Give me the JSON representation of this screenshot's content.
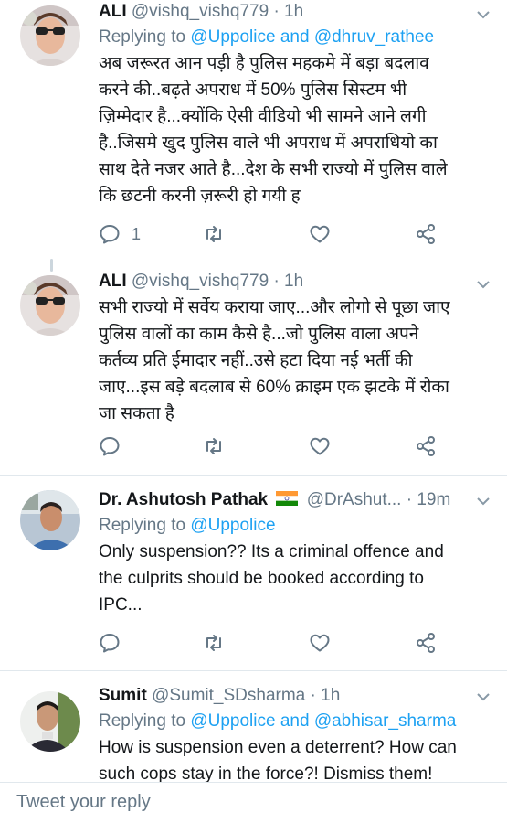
{
  "tweets": [
    {
      "name": "ALI",
      "handle": "@vishq_vishq779",
      "time": "1h",
      "replying_prefix": "Replying to",
      "replying_to": "@Uppolice and @dhruv_rathee",
      "lines": [
        "अब जरूरत आन पड़ी है पुलिस महकमे में बड़ा बदलाव",
        "करने की..बढ़ते अपराध में 50% पुलिस सिस्टम भी",
        "ज़िम्मेदार है...क्योंकि ऐसी वीडियो भी सामने आने लगी",
        "है..जिसमे खुद पुलिस वाले भी अपराध में  अपराधियो का",
        "साथ देते नजर आते है...देश के सभी राज्यो में पुलिस वाले",
        "कि छटनी करनी ज़रूरी हो गयी ह"
      ],
      "reply_count": "1"
    },
    {
      "name": "ALI",
      "handle": "@vishq_vishq779",
      "time": "1h",
      "lines": [
        "सभी राज्यो में सर्वेय कराया जाए...और लोगो से पूछा जाए",
        "पुलिस वालों का काम कैसे है...जो पुलिस वाला अपने",
        "कर्तव्य प्रति ईमादार नहीं..उसे हटा दिया नई भर्ती की",
        "जाए...इस बड़े बदलाब से 60% क्राइम एक झटके में रोका",
        "जा सकता है"
      ]
    },
    {
      "name": "Dr. Ashutosh Pathak",
      "handle": "@DrAshut...",
      "time": "19m",
      "replying_prefix": "Replying to",
      "replying_to": "@Uppolice",
      "lines": [
        "Only suspension?? Its a criminal offence and",
        "the culprits should be booked according to",
        "IPC..."
      ]
    },
    {
      "name": "Sumit",
      "handle": "@Sumit_SDsharma",
      "time": "1h",
      "replying_prefix": "Replying to",
      "replying_to": "@Uppolice and @abhisar_sharma",
      "lines": [
        "How is suspension even a deterrent? How can",
        "such cops stay in the force?! Dismiss them!"
      ]
    }
  ],
  "composer": {
    "placeholder": "Tweet your reply"
  },
  "icons": {
    "reply": "reply-icon",
    "retweet": "retweet-icon",
    "like": "like-icon",
    "share": "share-icon",
    "caret": "chevron-down-icon",
    "flag": "india-flag-icon"
  },
  "colors": {
    "link": "#1da1f2",
    "muted": "#657786",
    "text": "#14171a"
  }
}
